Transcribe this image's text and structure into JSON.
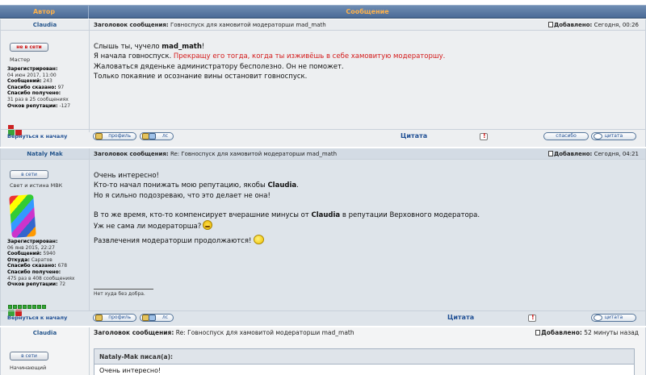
{
  "header": {
    "author": "Автор",
    "message": "Сообщение"
  },
  "posts": [
    {
      "author": "Claudia",
      "subject_label": "Заголовок сообщения:",
      "subject": "Говноспуск для хамовитой модераторши mad_math",
      "added_label": "Добавлено:",
      "added": "Сегодня, 00:26",
      "status": "не в сети",
      "rank": "Мастер",
      "info": {
        "registered_label": "Зарегистрирован:",
        "registered": "04 июн 2017, 11:00",
        "posts_label": "Сообщений:",
        "posts": "243",
        "thanks_said_label": "Спасибо сказано:",
        "thanks_said": "97",
        "thanks_got_label": "Спасибо получено:",
        "thanks_got": "31 раз в 25 сообщениях",
        "rep_label": "Очков репутации:",
        "rep": "-127"
      },
      "lines": [
        [
          "Слышь ты, чучело ",
          "mad_math",
          "!"
        ],
        [
          "Я начала говноспуск. ",
          "Прекращу его тогда, когда ты изживёшь в себе хамовитую модераторшу."
        ],
        [
          "Жаловаться дяденьке администратору бесполезно. Он не поможет."
        ],
        [
          "Только покаяние и осознание вины остановит говноспуск."
        ]
      ]
    },
    {
      "author": "Nataly Mak",
      "subject_label": "Заголовок сообщения:",
      "subject": "Re: Говноспуск для хамовитой модераторши mad_math",
      "added_label": "Добавлено:",
      "added": "Сегодня, 04:21",
      "status": "в сети",
      "rank": "Свет и истина МВК",
      "info": {
        "registered_label": "Зарегистрирован:",
        "registered": "06 янв 2015, 22:27",
        "posts_label": "Сообщений:",
        "posts": "5940",
        "from_label": "Откуда:",
        "from": "Саратов",
        "thanks_said_label": "Спасибо сказано:",
        "thanks_said": "678",
        "thanks_got_label": "Спасибо получено:",
        "thanks_got": "475 раз в 408 сообщениях",
        "rep_label": "Очков репутации:",
        "rep": "72"
      },
      "lines": [
        "Очень интересно!",
        "Кто-то начал понижать мою репутацию, якобы",
        "Claudia",
        "Но я сильно подозреваю, что это делает не она!",
        "В то же время, кто-то компенсирует вчерашние минусы от",
        "в репутации Верховного модератора.",
        "Уж не сама ли модераторша?",
        "Развлечения модераторши продолжаются!"
      ],
      "signature": "Нет худа без добра."
    },
    {
      "author": "Claudia",
      "subject_label": "Заголовок сообщения:",
      "subject": "Re: Говноспуск для хамовитой модераторши mad_math",
      "added_label": "Добавлено:",
      "added": "52 минуты назад",
      "status": "в сети",
      "rank": "Начинающий",
      "quote_head": "Nataly-Mak писал(а):",
      "quote_text": "Очень интересно!"
    }
  ],
  "footer": {
    "back": "Вернуться к началу",
    "profile": "профиль",
    "pm": "лс",
    "quote_main": "Цитата",
    "thanks": "спасибо",
    "quote": "цитата"
  }
}
